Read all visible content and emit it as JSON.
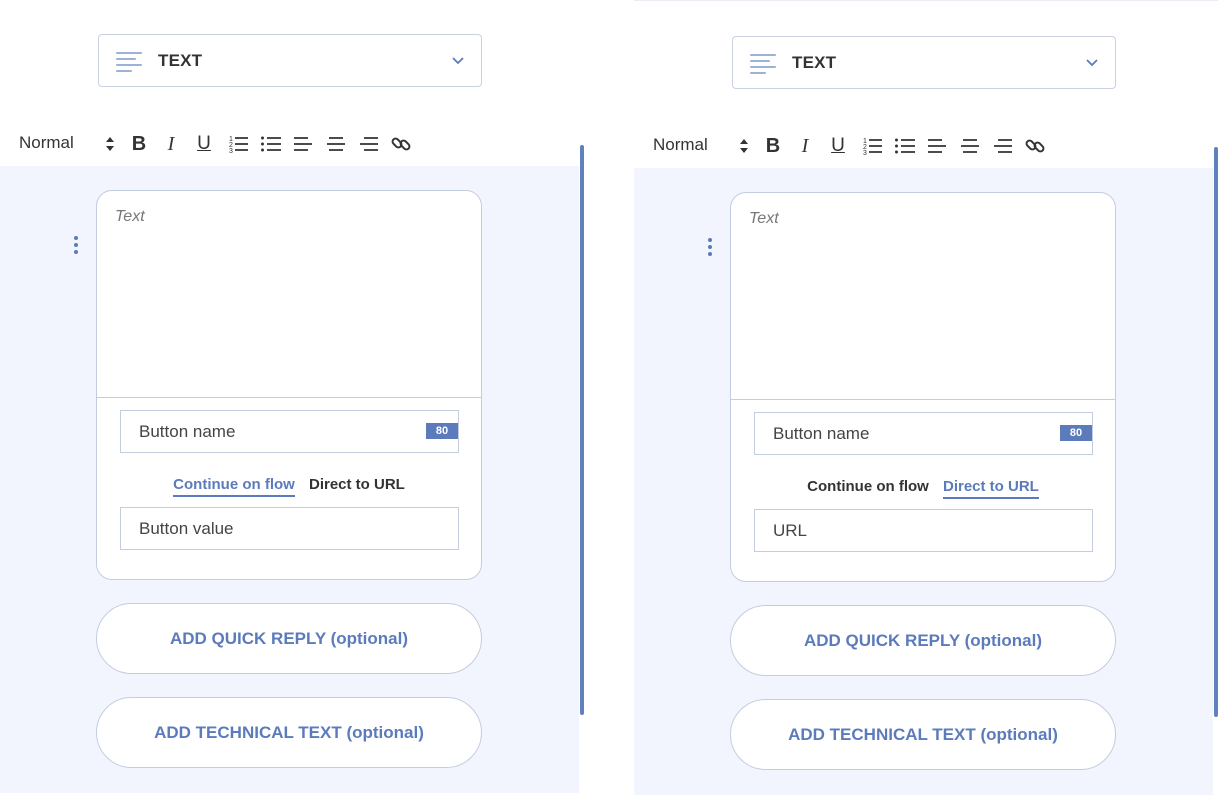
{
  "panels": [
    {
      "dropdown": {
        "label": "TEXT"
      },
      "toolbar": {
        "format_label": "Normal"
      },
      "card": {
        "placeholder": "Text",
        "button_name": "Button name",
        "char_limit": "80",
        "options": [
          "Continue on flow",
          "Direct to URL"
        ],
        "active_option": "Continue on flow",
        "second_field": "Button value"
      },
      "quick_reply": "ADD QUICK REPLY (optional)",
      "technical_text": "ADD TECHNICAL TEXT (optional)"
    },
    {
      "dropdown": {
        "label": "TEXT"
      },
      "toolbar": {
        "format_label": "Normal"
      },
      "card": {
        "placeholder": "Text",
        "button_name": "Button name",
        "char_limit": "80",
        "options": [
          "Continue on flow",
          "Direct to URL"
        ],
        "active_option": "Direct to URL",
        "second_field": "URL"
      },
      "quick_reply": "ADD QUICK REPLY (optional)",
      "technical_text": "ADD TECHNICAL TEXT (optional)"
    }
  ],
  "toolbar_icons": [
    "sort-icon",
    "bold-icon",
    "italic-icon",
    "underline-icon",
    "ordered-list-icon",
    "bullet-list-icon",
    "align-left-icon",
    "align-center-icon",
    "align-right-icon",
    "link-icon"
  ],
  "colors": {
    "accent": "#5b7bbc",
    "background": "#f2f5fd",
    "border": "#c3cde0"
  }
}
